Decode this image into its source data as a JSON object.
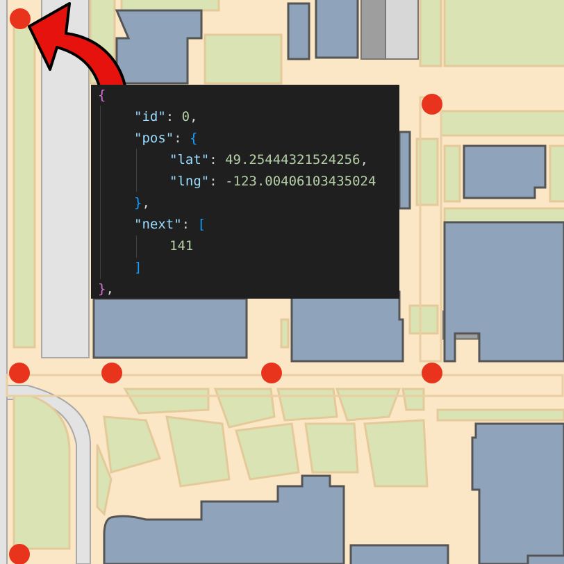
{
  "map": {
    "colors": {
      "background": "#fbe7c6",
      "road_outline": "#e9cfa3",
      "green": "#d9e3b3",
      "green_border": "#e4c99a",
      "building": "#8fa3ba",
      "building_border": "#555555",
      "gray_lot": "#9e9e9e",
      "highway": "#e3e3e3",
      "highway_border": "#a8a8a8",
      "marker": "#e8341c",
      "arrow": "#e6120d"
    },
    "markers": [
      "node-a",
      "node-b",
      "node-c",
      "node-d",
      "node-e",
      "node-f",
      "node-g",
      "node-h"
    ]
  },
  "code": {
    "line1_open": "{",
    "id_key": "\"id\"",
    "id_value": "0",
    "pos_key": "\"pos\"",
    "pos_open": "{",
    "lat_key": "\"lat\"",
    "lat_value": "49.25444321524256",
    "lng_key": "\"lng\"",
    "lng_value": "-123.00406103435024",
    "pos_close": "}",
    "next_key": "\"next\"",
    "next_open": "[",
    "next_value": "141",
    "next_close": "]",
    "line_close": "}"
  }
}
